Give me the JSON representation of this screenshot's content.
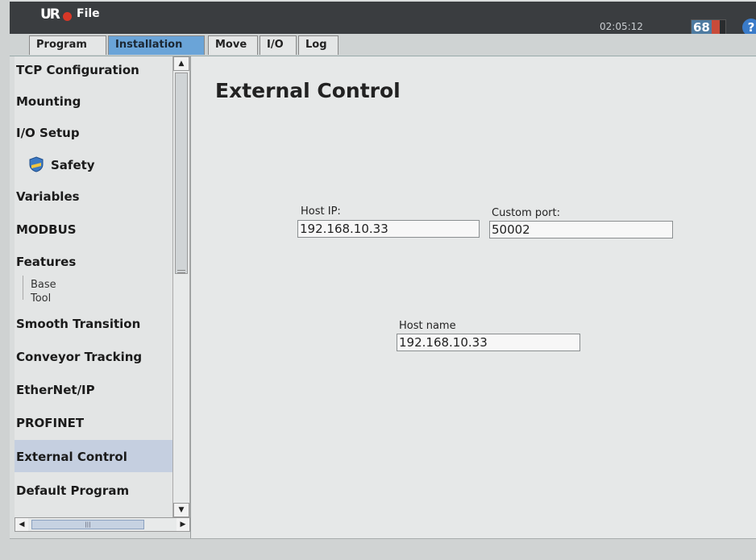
{
  "header": {
    "logo": "UR",
    "file_menu": "File",
    "clock": "02:05:12",
    "speed": "68",
    "help": "?"
  },
  "tabs": [
    {
      "label": "Program"
    },
    {
      "label": "Installation"
    },
    {
      "label": "Move"
    },
    {
      "label": "I/O"
    },
    {
      "label": "Log"
    }
  ],
  "sidebar": {
    "items": [
      {
        "label": "TCP Configuration"
      },
      {
        "label": "Mounting"
      },
      {
        "label": "I/O Setup"
      },
      {
        "label": "Safety"
      },
      {
        "label": "Variables"
      },
      {
        "label": "MODBUS"
      },
      {
        "label": "Features"
      },
      {
        "label": "Smooth Transition"
      },
      {
        "label": "Conveyor Tracking"
      },
      {
        "label": "EtherNet/IP"
      },
      {
        "label": "PROFINET"
      },
      {
        "label": "External Control"
      },
      {
        "label": "Default Program"
      }
    ],
    "feature_children": [
      "Base",
      "Tool"
    ],
    "selected": "External Control"
  },
  "main": {
    "title": "External Control",
    "host_ip_label": "Host IP:",
    "host_ip_value": "192.168.10.33",
    "custom_port_label": "Custom port:",
    "custom_port_value": "50002",
    "host_name_label": "Host name",
    "host_name_value": "192.168.10.33"
  }
}
